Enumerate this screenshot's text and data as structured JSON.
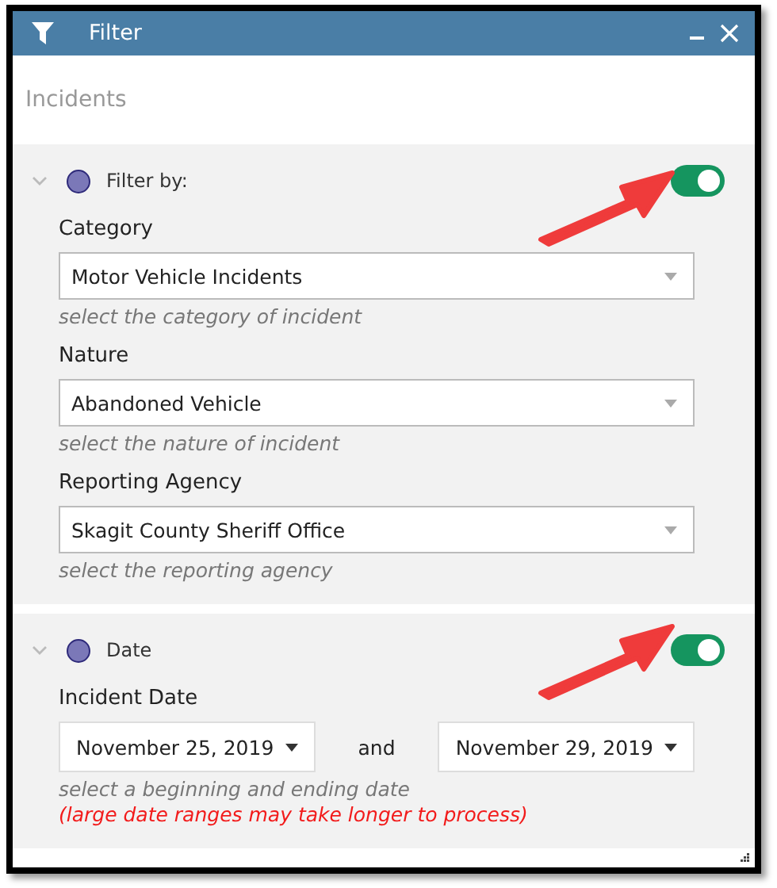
{
  "window": {
    "title": "Filter"
  },
  "heading": "Incidents",
  "sections": [
    {
      "kind": "fields",
      "title": "Filter by:",
      "expanded": true,
      "enabled": true,
      "fields": [
        {
          "label": "Category",
          "value": "Motor Vehicle Incidents",
          "hint": "select the category of incident"
        },
        {
          "label": "Nature",
          "value": "Abandoned Vehicle",
          "hint": "select the nature of incident"
        },
        {
          "label": "Reporting Agency",
          "value": "Skagit County Sheriff Office",
          "hint": "select the reporting agency"
        }
      ]
    },
    {
      "kind": "date_range",
      "title": "Date",
      "expanded": true,
      "enabled": true,
      "label": "Incident Date",
      "start": "November 25, 2019",
      "joiner": "and",
      "end": "November 29, 2019",
      "hint": "select a beginning and ending date",
      "warning": "(large date ranges may take longer to process)"
    }
  ]
}
